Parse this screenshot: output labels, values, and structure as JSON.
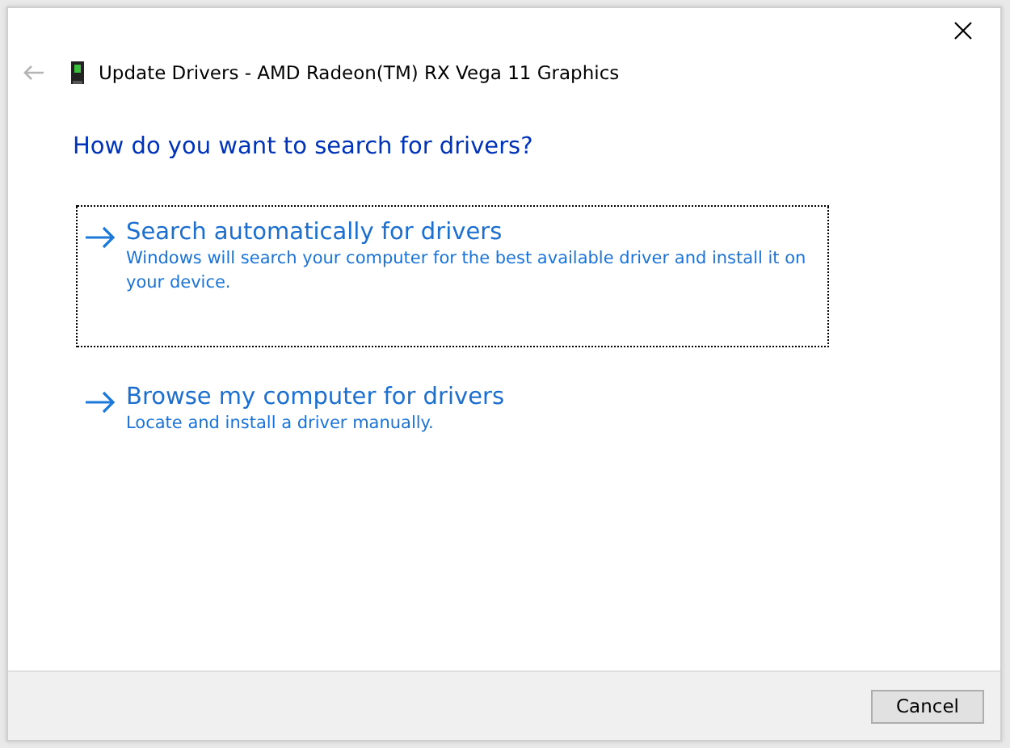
{
  "window": {
    "title": "Update Drivers - AMD Radeon(TM) RX Vega 11 Graphics"
  },
  "heading": "How do you want to search for drivers?",
  "options": [
    {
      "title": "Search automatically for drivers",
      "description": "Windows will search your computer for the best available driver and install it on your device.",
      "focused": true
    },
    {
      "title": "Browse my computer for drivers",
      "description": "Locate and install a driver manually.",
      "focused": false
    }
  ],
  "buttons": [
    "Cancel"
  ]
}
